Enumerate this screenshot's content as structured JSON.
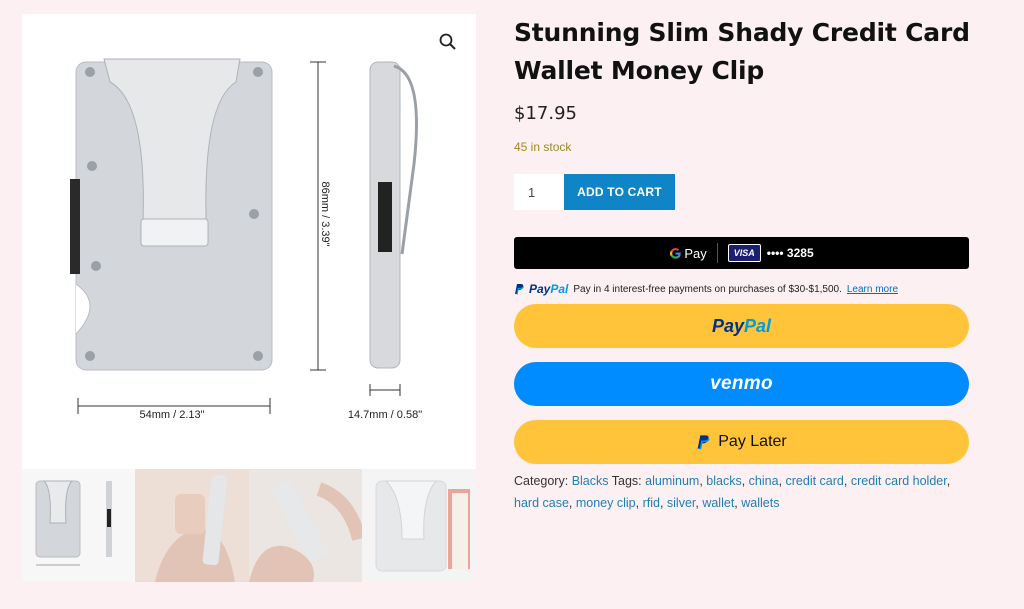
{
  "product": {
    "title": "Stunning Slim Shady Credit Card Wallet Money Clip",
    "price": "$17.95",
    "stock": "45 in stock",
    "quantity": "1",
    "add_to_cart_label": "ADD TO CART"
  },
  "gallery": {
    "dimension_width": "54mm / 2.13\"",
    "dimension_height": "86mm / 3.39\"",
    "dimension_depth": "14.7mm / 0.58\""
  },
  "payments": {
    "gpay_label": "Pay",
    "card_brand": "VISA",
    "card_masked": "•••• 3285",
    "paypal_msg_brand_1": "Pay",
    "paypal_msg_brand_2": "Pal",
    "paypal_msg_text": "Pay in 4 interest-free payments on purchases of $30-$1,500.",
    "paypal_msg_link": "Learn more",
    "paypal_btn_1": "Pay",
    "paypal_btn_2": "Pal",
    "venmo_label": "venmo",
    "pay_later_label": "Pay Later"
  },
  "meta": {
    "category_label": "Category:",
    "category": "Blacks",
    "tags_label": "Tags:",
    "tags": [
      "aluminum",
      "blacks",
      "china",
      "credit card",
      "credit card holder",
      "hard case",
      "money clip",
      "rfid",
      "silver",
      "wallet",
      "wallets"
    ]
  },
  "colors": {
    "background": "#fdf0f3",
    "add_to_cart": "#0f84c6",
    "paypal_yellow": "#ffc439",
    "venmo_blue": "#008cff",
    "link": "#1e7fb6",
    "stock": "#9c8a1f"
  },
  "icons": {
    "zoom": "magnifier-icon",
    "gpay": "google-g-icon",
    "paypal": "paypal-p-icon"
  }
}
